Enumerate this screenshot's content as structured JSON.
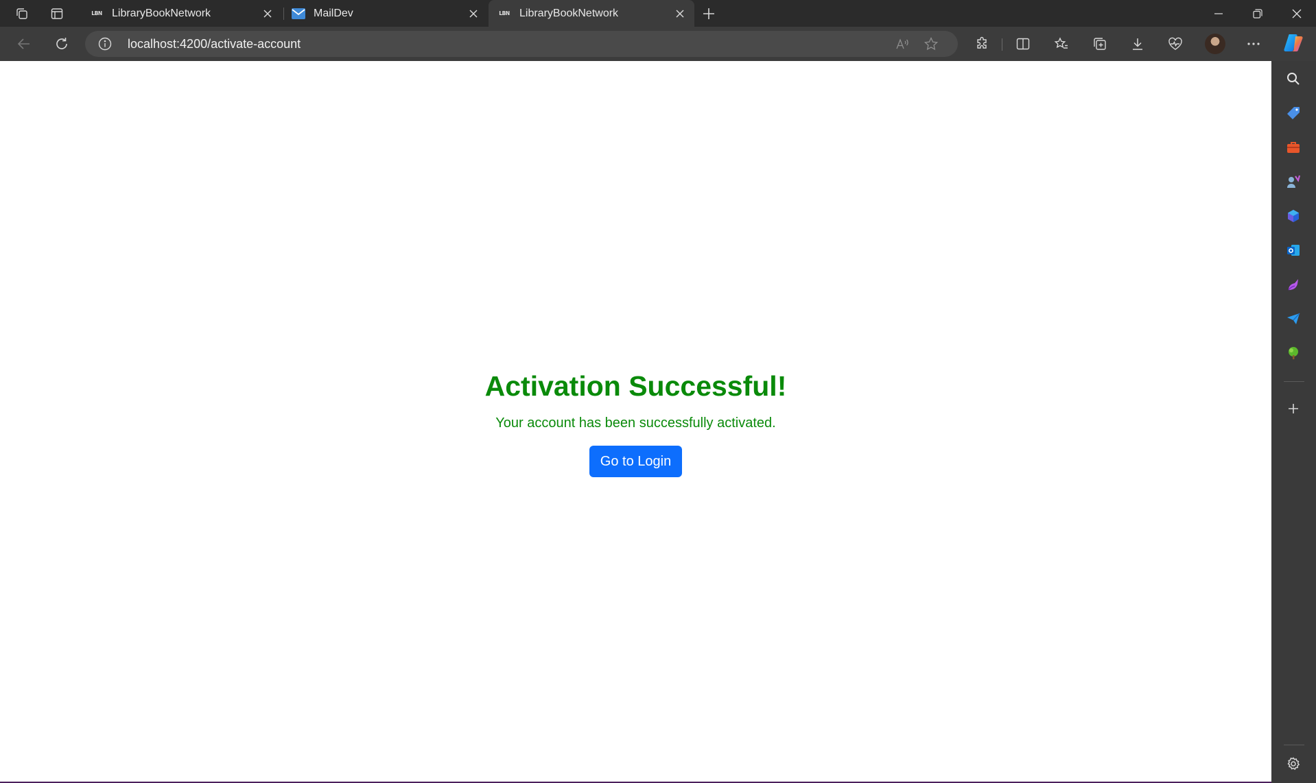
{
  "browser": {
    "tabs": [
      {
        "title": "LibraryBookNetwork",
        "favicon": "LBN",
        "active": false
      },
      {
        "title": "MailDev",
        "favicon": "mail-icon",
        "active": false
      },
      {
        "title": "LibraryBookNetwork",
        "favicon": "LBN",
        "active": true
      }
    ],
    "url": "localhost:4200/activate-account"
  },
  "page": {
    "title": "Activation Successful!",
    "message": "Your account has been successfully activated.",
    "login_button": "Go to Login"
  },
  "colors": {
    "success_green": "#0a8a0a",
    "primary_button": "#0d6efd",
    "browser_chrome": "#2b2b2b",
    "toolbar": "#3c3c3c",
    "sidebar": "#3a3a3a"
  },
  "sidebar_icons": [
    "search-icon",
    "shopping-tag-icon",
    "tools-icon",
    "games-icon",
    "microsoft-365-icon",
    "outlook-icon",
    "designer-icon",
    "send-icon",
    "tree-icon",
    "add-icon",
    "settings-icon"
  ]
}
